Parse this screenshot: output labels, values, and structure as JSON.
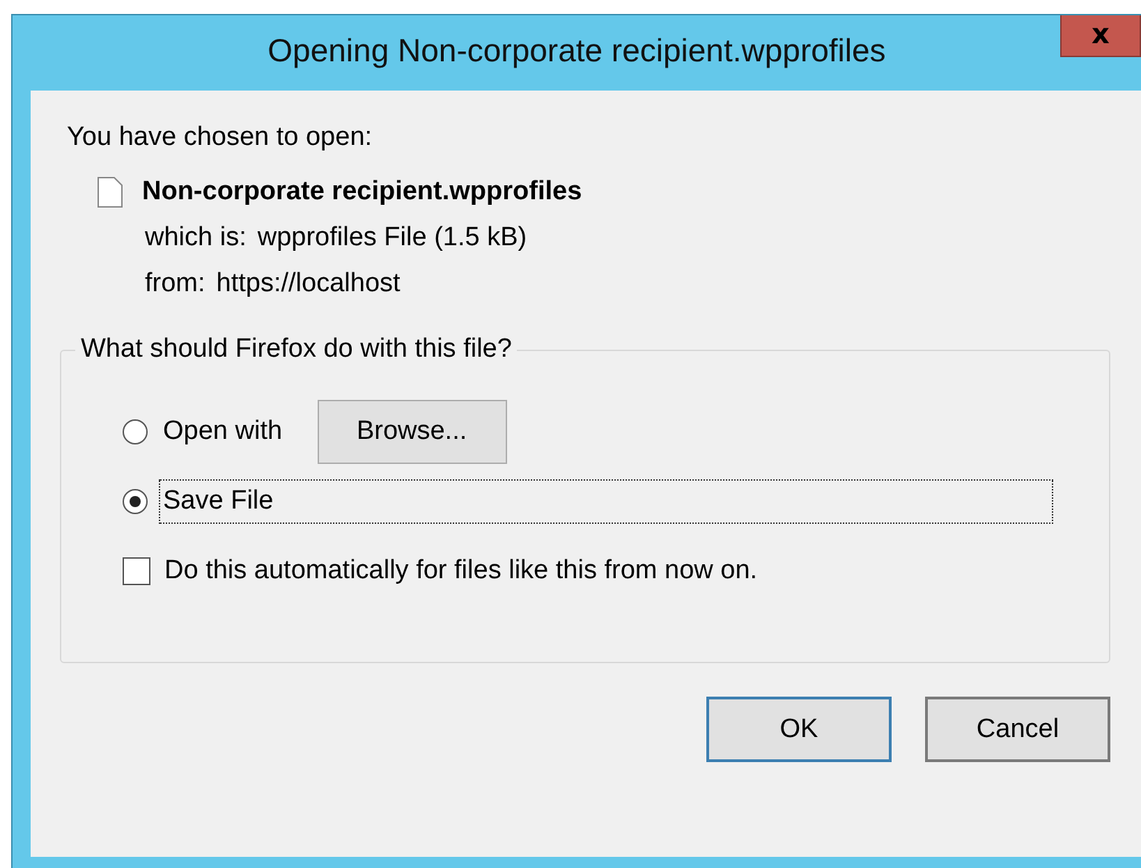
{
  "window": {
    "title": "Opening Non-corporate recipient.wpprofiles",
    "close": "x"
  },
  "intro": "You have chosen to open:",
  "file": {
    "name": "Non-corporate recipient.wpprofiles",
    "details": [
      {
        "label": "which is:",
        "value": "wpprofiles File (1.5 kB)"
      },
      {
        "label": "from:",
        "value": "https://localhost"
      }
    ]
  },
  "action_group": {
    "legend": "What should Firefox do with this file?",
    "options": [
      {
        "kind": "radio",
        "label": "Open with",
        "selected": false,
        "focused": false,
        "button": "Browse..."
      },
      {
        "kind": "radio",
        "label": "Save File",
        "selected": true,
        "focused": true
      }
    ]
  },
  "remember": {
    "label": "Do this automatically for files like this from now on.",
    "checked": false
  },
  "buttons": [
    {
      "label": "OK",
      "default": true
    },
    {
      "label": "Cancel",
      "default": false
    }
  ]
}
